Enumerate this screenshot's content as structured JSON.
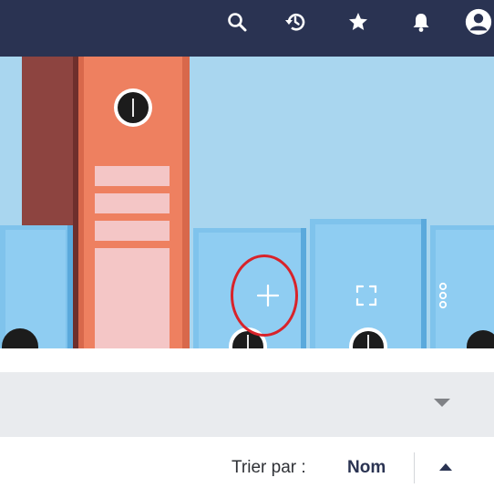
{
  "header": {
    "icons": {
      "search": "search-icon",
      "history": "history-icon",
      "favorites": "star-icon",
      "notifications": "bell-icon",
      "account": "account-icon"
    },
    "background_color": "#2a3352"
  },
  "hero": {
    "actions": {
      "add": "plus-icon",
      "fullscreen": "fullscreen-icon",
      "more": "more-vertical-icon"
    },
    "highlight_color": "#d8232a"
  },
  "filter": {
    "selected_value": ""
  },
  "sort": {
    "label": "Trier par :",
    "value": "Nom",
    "direction": "ascending"
  }
}
